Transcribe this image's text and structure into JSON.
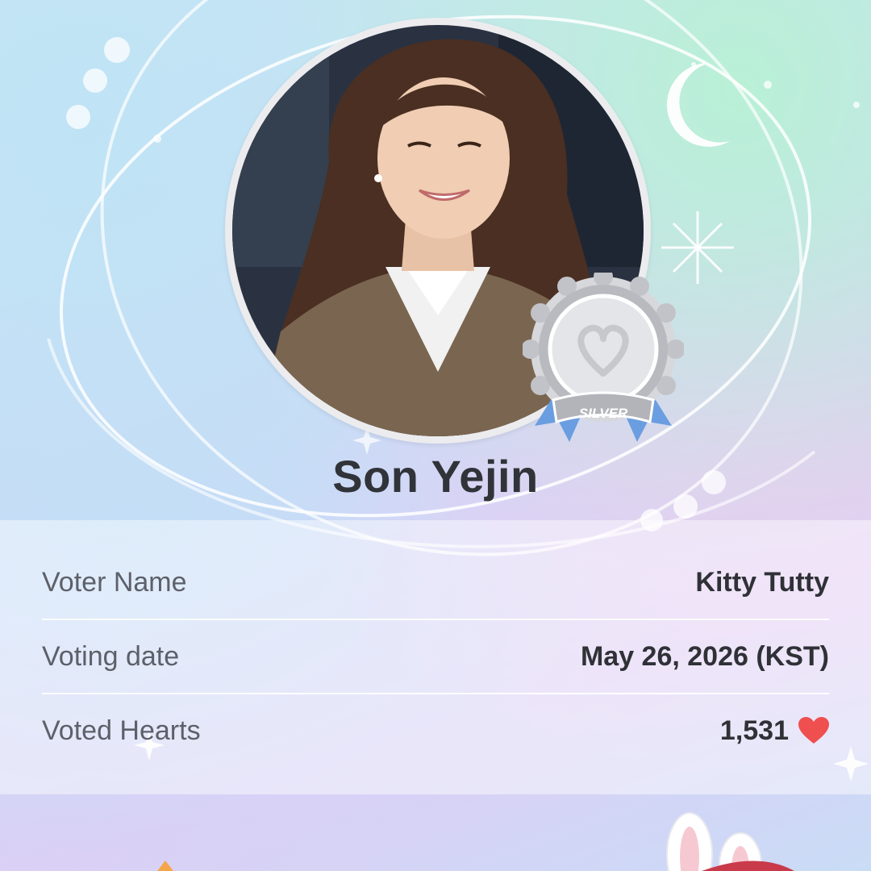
{
  "celebrity": {
    "name": "Son Yejin",
    "badge_label": "SILVER",
    "badge_level": "silver"
  },
  "vote_info": {
    "rows": [
      {
        "label": "Voter Name",
        "value": "Kitty Tutty"
      },
      {
        "label": "Voting date",
        "value": "May 26, 2026 (KST)"
      },
      {
        "label": "Voted Hearts",
        "value": "1,531"
      }
    ],
    "heart_icon": "heart-icon"
  },
  "colors": {
    "heart": "#ef4f4f",
    "text_dark": "#2f3136",
    "text_label": "#5d6069",
    "badge_silver": "#c8c9cd",
    "ribbon_blue": "#6b9ee0"
  }
}
